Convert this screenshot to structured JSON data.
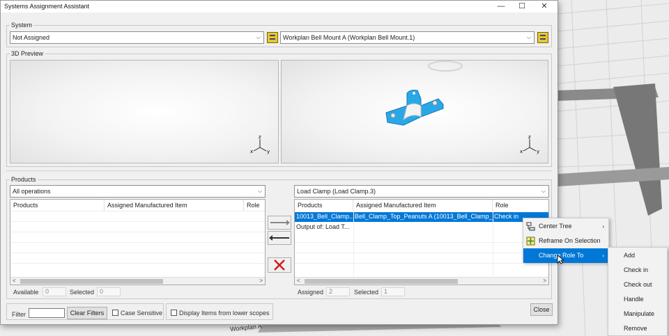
{
  "window": {
    "title": "Systems Assignment Assistant",
    "minimize": "—",
    "maximize": "☐",
    "close": "✕"
  },
  "system": {
    "group_label": "System",
    "left_combo": "Not Assigned",
    "right_combo": "Workplan Bell Mount A (Workplan Bell Mount.1)"
  },
  "preview": {
    "group_label": "3D Preview"
  },
  "products": {
    "group_label": "Products",
    "left_filter": "All operations",
    "right_filter": "Load Clamp (Load Clamp.3)",
    "columns": [
      "Products",
      "Assigned Manufactured Item",
      "Role"
    ],
    "left_rows": [],
    "right_rows": [
      {
        "product": "10013_Bell_Clamp...",
        "item": "Bell_Clamp_Top_Peanuts A (10013_Bell_Clamp_...",
        "role": "Check in",
        "selected": true
      },
      {
        "product": "Output of: Load T...",
        "item": "",
        "role": "",
        "selected": false
      }
    ],
    "available_label": "Available",
    "available_value": "0",
    "selected_label": "Selected",
    "left_selected_value": "0",
    "assigned_label": "Assigned",
    "assigned_value": "2",
    "right_selected_value": "1"
  },
  "bottom": {
    "filter_label": "Filter",
    "filter_value": "",
    "clear_filters": "Clear Filters",
    "case_sensitive": "Case Sensitive",
    "lower_scopes": "Display Items from lower scopes",
    "close": "Close"
  },
  "context_menu": {
    "items": [
      "Center Tree",
      "Reframe On Selection",
      "Change Role To"
    ],
    "submenu": [
      "Add",
      "Check in",
      "Check out",
      "Handle",
      "Manipulate",
      "Remove"
    ]
  },
  "background_label": "Workplan A",
  "colors": {
    "accent": "#0078d7",
    "icon_yellow": "#e8c72c",
    "part_blue": "#29a8e8",
    "delete_red": "#d11b1b"
  }
}
